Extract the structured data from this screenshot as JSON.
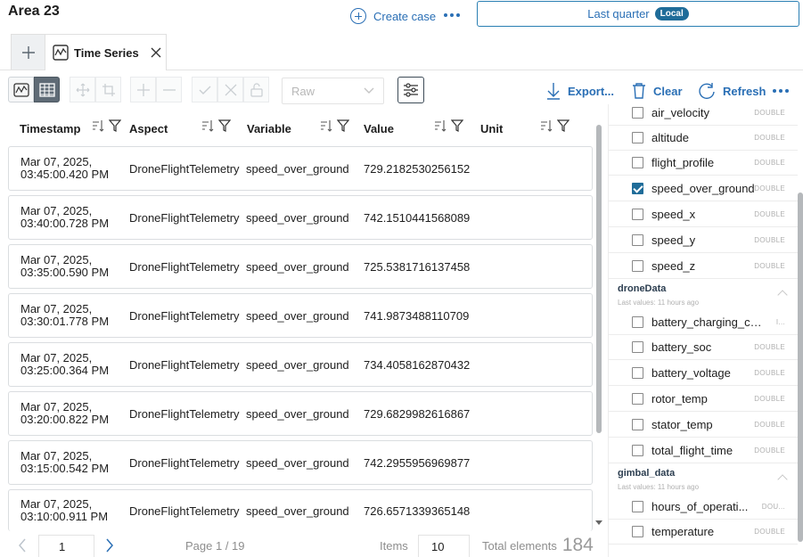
{
  "header": {
    "title": "Area 23",
    "create_case_label": "Create case",
    "time_range_label": "Last quarter",
    "time_range_badge": "Local"
  },
  "tabs": [
    {
      "label": "Time Series",
      "active": true
    }
  ],
  "toolbar": {
    "aggregation_value": "Raw",
    "export_label": "Export...",
    "clear_label": "Clear",
    "refresh_label": "Refresh"
  },
  "table": {
    "columns": [
      "Timestamp",
      "Aspect",
      "Variable",
      "Value",
      "Unit"
    ],
    "rows": [
      {
        "ts1": "Mar 07, 2025,",
        "ts2": "03:45:00.420 PM",
        "aspect": "DroneFlightTelemetry",
        "variable": "speed_over_ground",
        "value": "729.2182530256152",
        "unit": ""
      },
      {
        "ts1": "Mar 07, 2025,",
        "ts2": "03:40:00.728 PM",
        "aspect": "DroneFlightTelemetry",
        "variable": "speed_over_ground",
        "value": "742.1510441568089",
        "unit": ""
      },
      {
        "ts1": "Mar 07, 2025,",
        "ts2": "03:35:00.590 PM",
        "aspect": "DroneFlightTelemetry",
        "variable": "speed_over_ground",
        "value": "725.5381716137458",
        "unit": ""
      },
      {
        "ts1": "Mar 07, 2025,",
        "ts2": "03:30:01.778 PM",
        "aspect": "DroneFlightTelemetry",
        "variable": "speed_over_ground",
        "value": "741.9873488110709",
        "unit": ""
      },
      {
        "ts1": "Mar 07, 2025,",
        "ts2": "03:25:00.364 PM",
        "aspect": "DroneFlightTelemetry",
        "variable": "speed_over_ground",
        "value": "734.4058162870432",
        "unit": ""
      },
      {
        "ts1": "Mar 07, 2025,",
        "ts2": "03:20:00.822 PM",
        "aspect": "DroneFlightTelemetry",
        "variable": "speed_over_ground",
        "value": "729.6829982616867",
        "unit": ""
      },
      {
        "ts1": "Mar 07, 2025,",
        "ts2": "03:15:00.542 PM",
        "aspect": "DroneFlightTelemetry",
        "variable": "speed_over_ground",
        "value": "742.2955956969877",
        "unit": ""
      },
      {
        "ts1": "Mar 07, 2025,",
        "ts2": "03:10:00.911 PM",
        "aspect": "DroneFlightTelemetry",
        "variable": "speed_over_ground",
        "value": "726.6571339365148",
        "unit": ""
      }
    ]
  },
  "pagination": {
    "page": "1",
    "page_info": "Page 1 / 19",
    "items_label": "Items",
    "items_per_page": "10",
    "total_label": "Total elements",
    "total_count": "184"
  },
  "variables_panel": {
    "top_items": [
      {
        "name": "air_velocity",
        "type": "DOUBLE",
        "checked": false
      },
      {
        "name": "altitude",
        "type": "DOUBLE",
        "checked": false
      },
      {
        "name": "flight_profile",
        "type": "DOUBLE",
        "checked": false
      },
      {
        "name": "speed_over_ground",
        "type": "DOUBLE",
        "checked": true
      },
      {
        "name": "speed_x",
        "type": "DOUBLE",
        "checked": false
      },
      {
        "name": "speed_y",
        "type": "DOUBLE",
        "checked": false
      },
      {
        "name": "speed_z",
        "type": "DOUBLE",
        "checked": false
      }
    ],
    "groups": [
      {
        "name": "droneData",
        "subtitle": "Last values: 11 hours ago",
        "items": [
          {
            "name": "battery_charging_cyc...",
            "type": "I...",
            "checked": false
          },
          {
            "name": "battery_soc",
            "type": "DOUBLE",
            "checked": false
          },
          {
            "name": "battery_voltage",
            "type": "DOUBLE",
            "checked": false
          },
          {
            "name": "rotor_temp",
            "type": "DOUBLE",
            "checked": false
          },
          {
            "name": "stator_temp",
            "type": "DOUBLE",
            "checked": false
          },
          {
            "name": "total_flight_time",
            "type": "DOUBLE",
            "checked": false
          }
        ]
      },
      {
        "name": "gimbal_data",
        "subtitle": "Last values: 11 hours ago",
        "items": [
          {
            "name": "hours_of_operati...",
            "type": "DOU...",
            "checked": false
          },
          {
            "name": "temperature",
            "type": "DOUBLE",
            "checked": false
          }
        ]
      }
    ]
  }
}
